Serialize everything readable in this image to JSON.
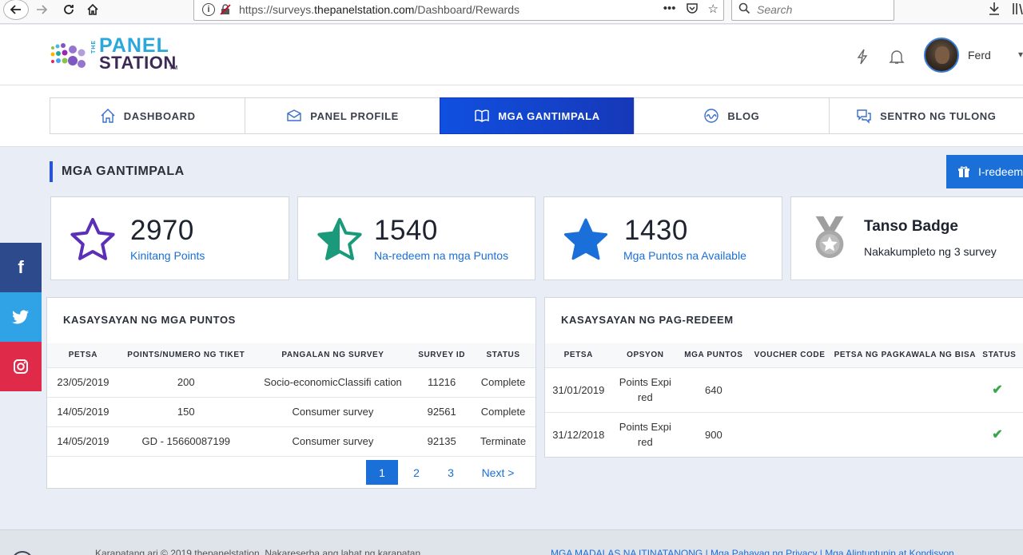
{
  "browser": {
    "url_prefix": "https://surveys.",
    "url_domain": "thepanelstation.com",
    "url_path": "/Dashboard/Rewards",
    "search_placeholder": "Search"
  },
  "header": {
    "logo_the": "THE",
    "logo_panel": "PANEL",
    "logo_station": "STATION",
    "logo_tm": "TM",
    "user_name": "Ferd"
  },
  "nav": {
    "tabs": [
      {
        "label": "DASHBOARD",
        "icon": "home-icon"
      },
      {
        "label": "PANEL PROFILE",
        "icon": "envelope-icon"
      },
      {
        "label": "MGA GANTIMPALA",
        "icon": "book-icon"
      },
      {
        "label": "BLOG",
        "icon": "wave-icon"
      },
      {
        "label": "SENTRO NG TULONG",
        "icon": "chat-icon"
      }
    ]
  },
  "page": {
    "title": "MGA GANTIMPALA",
    "redeem_label": "I-redeem"
  },
  "stats": {
    "earned": {
      "value": "2970",
      "label": "Kinitang Points",
      "color": "#5b2fb8"
    },
    "redeemed": {
      "value": "1540",
      "label": "Na-redeem na mga Puntos",
      "color": "#1a9a7a"
    },
    "available": {
      "value": "1430",
      "label": "Mga Puntos na Available",
      "color": "#1a6fd8"
    },
    "badge": {
      "title": "Tanso Badge",
      "subtitle": "Nakakumpleto ng 3 survey"
    }
  },
  "points_history": {
    "title": "KASAYSAYAN NG MGA PUNTOS",
    "headers": [
      "PETSA",
      "POINTS/NUMERO NG TIKET",
      "PANGALAN NG SURVEY",
      "SURVEY ID",
      "STATUS"
    ],
    "rows": [
      [
        "23/05/2019",
        "200",
        "Socio-economicClassifi cation",
        "11216",
        "Complete"
      ],
      [
        "14/05/2019",
        "150",
        "Consumer survey",
        "92561",
        "Complete"
      ],
      [
        "14/05/2019",
        "GD - 15660087199",
        "Consumer survey",
        "92135",
        "Terminate"
      ]
    ],
    "pager": [
      "1",
      "2",
      "3",
      "Next >"
    ]
  },
  "redeem_history": {
    "title": "KASAYSAYAN NG PAG-REDEEM",
    "headers": [
      "PETSA",
      "OPSYON",
      "MGA PUNTOS",
      "VOUCHER CODE",
      "PETSA NG PAGKAWALA NG BISA",
      "STATUS"
    ],
    "rows": [
      {
        "date": "31/01/2019",
        "option_l1": "Points Expi",
        "option_l2": "red",
        "points": "640",
        "voucher": "",
        "expiry": ""
      },
      {
        "date": "31/12/2018",
        "option_l1": "Points Expi",
        "option_l2": "red",
        "points": "900",
        "voucher": "",
        "expiry": ""
      }
    ]
  },
  "footer": {
    "copyright": "Karapatang ari © 2019 thepanelstation. Nakareserba ang lahat ng karapatan.",
    "links": "MGA MADALAS NA ITINATANONG | Mga Pahayag ng Privacy | Mga Alintuntunin at Kondisyon"
  },
  "colors": {
    "accent": "#1a6fd8",
    "nav_active": "#1638b8",
    "check": "#3aa64a"
  }
}
